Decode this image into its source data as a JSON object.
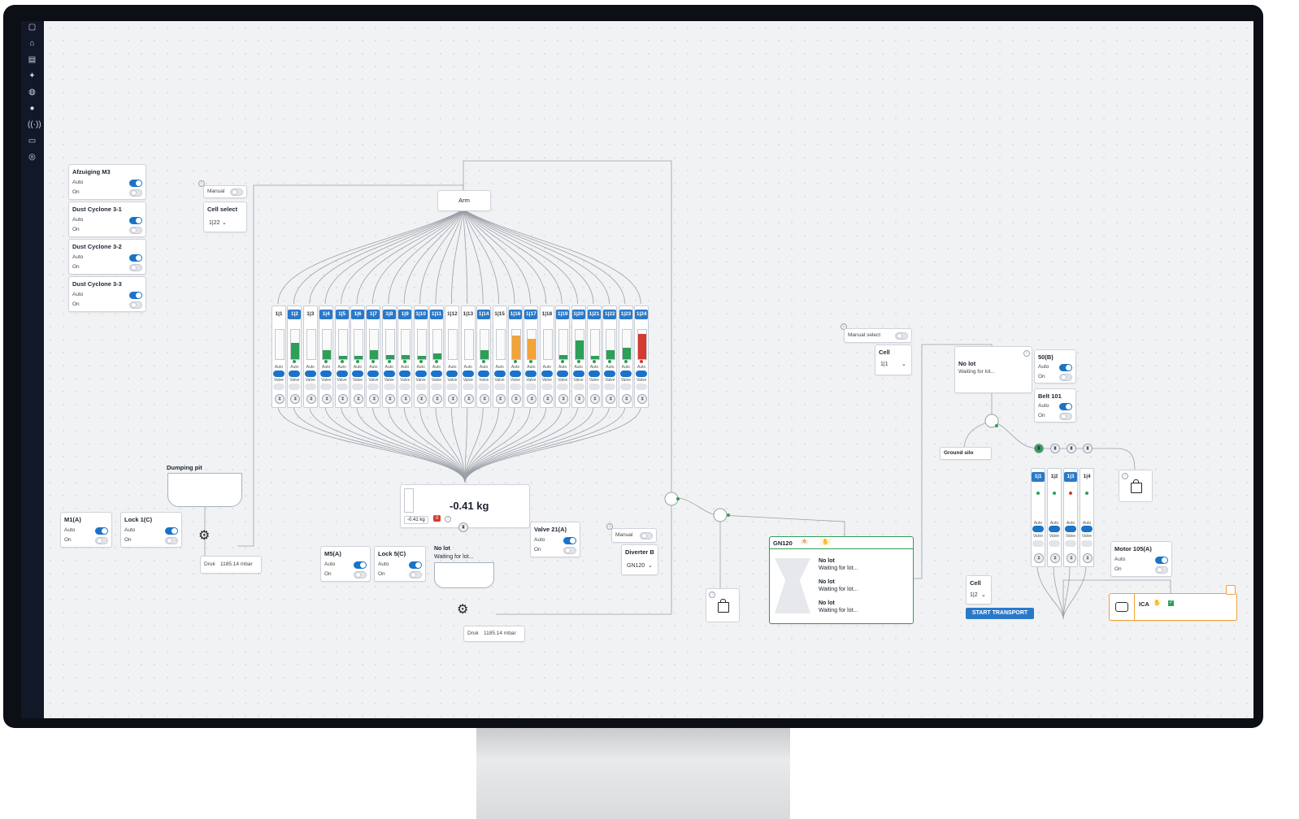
{
  "rail_icons": [
    "home-icon",
    "settings-icon",
    "chart-icon",
    "bulb-icon",
    "database-icon",
    "user-icon",
    "signal-icon",
    "terminal-icon",
    "help-icon"
  ],
  "left_controls": [
    {
      "title": "Afzuiging M3",
      "auto": "Auto",
      "on": "On"
    },
    {
      "title": "Dust Cyclone 3-1",
      "auto": "Auto",
      "on": "On"
    },
    {
      "title": "Dust Cyclone 3-2",
      "auto": "Auto",
      "on": "On"
    },
    {
      "title": "Dust Cyclone 3-3",
      "auto": "Auto",
      "on": "On"
    }
  ],
  "manual_left": {
    "label": "Manual"
  },
  "cell_select_left": {
    "title": "Cell select",
    "value": "1|22"
  },
  "arm": {
    "label": "Arm"
  },
  "cells": [
    {
      "label": "1|1",
      "fill": 0,
      "color": "#ffffff",
      "hl": false
    },
    {
      "label": "1|2",
      "fill": 0.55,
      "color": "#2e9e58",
      "hl": true
    },
    {
      "label": "1|3",
      "fill": 0,
      "color": "#ffffff",
      "hl": false
    },
    {
      "label": "1|4",
      "fill": 0.3,
      "color": "#2e9e58",
      "hl": true
    },
    {
      "label": "1|5",
      "fill": 0.1,
      "color": "#2e9e58",
      "hl": true
    },
    {
      "label": "1|6",
      "fill": 0.1,
      "color": "#2e9e58",
      "hl": true
    },
    {
      "label": "1|7",
      "fill": 0.3,
      "color": "#2e9e58",
      "hl": true
    },
    {
      "label": "1|8",
      "fill": 0.15,
      "color": "#2e9e58",
      "hl": true
    },
    {
      "label": "1|9",
      "fill": 0.15,
      "color": "#2e9e58",
      "hl": true
    },
    {
      "label": "1|10",
      "fill": 0.1,
      "color": "#2e9e58",
      "hl": true
    },
    {
      "label": "1|11",
      "fill": 0.2,
      "color": "#2e9e58",
      "hl": true
    },
    {
      "label": "1|12",
      "fill": 0,
      "color": "#ffffff",
      "hl": false
    },
    {
      "label": "1|13",
      "fill": 0,
      "color": "#ffffff",
      "hl": false
    },
    {
      "label": "1|14",
      "fill": 0.3,
      "color": "#2e9e58",
      "hl": true
    },
    {
      "label": "1|15",
      "fill": 0,
      "color": "#ffffff",
      "hl": false
    },
    {
      "label": "1|16",
      "fill": 0.8,
      "color": "#f2a33a",
      "hl": true
    },
    {
      "label": "1|17",
      "fill": 0.7,
      "color": "#f2a33a",
      "hl": true
    },
    {
      "label": "1|18",
      "fill": 0,
      "color": "#ffffff",
      "hl": false
    },
    {
      "label": "1|19",
      "fill": 0.15,
      "color": "#2e9e58",
      "hl": true
    },
    {
      "label": "1|20",
      "fill": 0.65,
      "color": "#2e9e58",
      "hl": true
    },
    {
      "label": "1|21",
      "fill": 0.1,
      "color": "#2e9e58",
      "hl": true
    },
    {
      "label": "1|22",
      "fill": 0.3,
      "color": "#2e9e58",
      "hl": true
    },
    {
      "label": "1|23",
      "fill": 0.4,
      "color": "#2e9e58",
      "hl": true
    },
    {
      "label": "1|24",
      "fill": 0.85,
      "color": "#d33a32",
      "hl": true
    }
  ],
  "cell_auto": "Auto",
  "cell_valve": "Valve",
  "scale": {
    "weight": "-0.41 kg",
    "small": "-0.41 kg",
    "count": "0"
  },
  "dumping_pit": {
    "title": "Dumping pit"
  },
  "m1": {
    "title": "M1(A)",
    "auto": "Auto",
    "on": "On"
  },
  "lock1": {
    "title": "Lock 1(C)",
    "auto": "Auto",
    "on": "On"
  },
  "druk1": {
    "label": "Druk",
    "value": "1185.14 mbar"
  },
  "m5": {
    "title": "M5(A)",
    "auto": "Auto",
    "on": "On"
  },
  "lock5": {
    "title": "Lock 5(C)",
    "auto": "Auto",
    "on": "On"
  },
  "nolot_mid": {
    "title": "No lot",
    "sub": "Waiting for lot..."
  },
  "valve21": {
    "title": "Valve 21(A)",
    "auto": "Auto",
    "on": "On"
  },
  "druk2": {
    "label": "Druk",
    "value": "1185.14 mbar"
  },
  "manual_mid": {
    "label": "Manual"
  },
  "diverter": {
    "title": "Diverter B",
    "value": "GN120"
  },
  "gn120": {
    "title": "GN120",
    "badge": "6",
    "lots": [
      {
        "t": "No lot",
        "s": "Waiting for lot..."
      },
      {
        "t": "No lot",
        "s": "Waiting for lot..."
      },
      {
        "t": "No lot",
        "s": "Waiting for lot..."
      }
    ]
  },
  "manual_select": {
    "label": "Manual select"
  },
  "cell_right": {
    "title": "Cell",
    "value": "1|1"
  },
  "nolot_right": {
    "title": "No lot",
    "sub": "Waiting for lot..."
  },
  "s50b": {
    "title": "50(B)",
    "auto": "Auto",
    "on": "On"
  },
  "belt101": {
    "title": "Belt 101",
    "auto": "Auto",
    "on": "On"
  },
  "ground_silo": {
    "label": "Ground silo"
  },
  "right_cells": [
    {
      "label": "1|1",
      "hl": true,
      "dot": "#2e9e58"
    },
    {
      "label": "1|2",
      "hl": false,
      "dot": "#2e9e58"
    },
    {
      "label": "1|3",
      "hl": true,
      "dot": "#d33a32"
    },
    {
      "label": "1|4",
      "hl": false,
      "dot": "#2e9e58"
    }
  ],
  "motor105": {
    "title": "Motor 105(A)",
    "auto": "Auto",
    "on": "On"
  },
  "cell_bottom": {
    "title": "Cell",
    "value": "1|2"
  },
  "start_transport": {
    "label": "START TRANSPORT"
  },
  "ica": {
    "title": "ICA"
  },
  "colors": {
    "accent": "#1a73c8",
    "green": "#2e9e58",
    "orange": "#f2a33a",
    "red": "#d33a32"
  }
}
